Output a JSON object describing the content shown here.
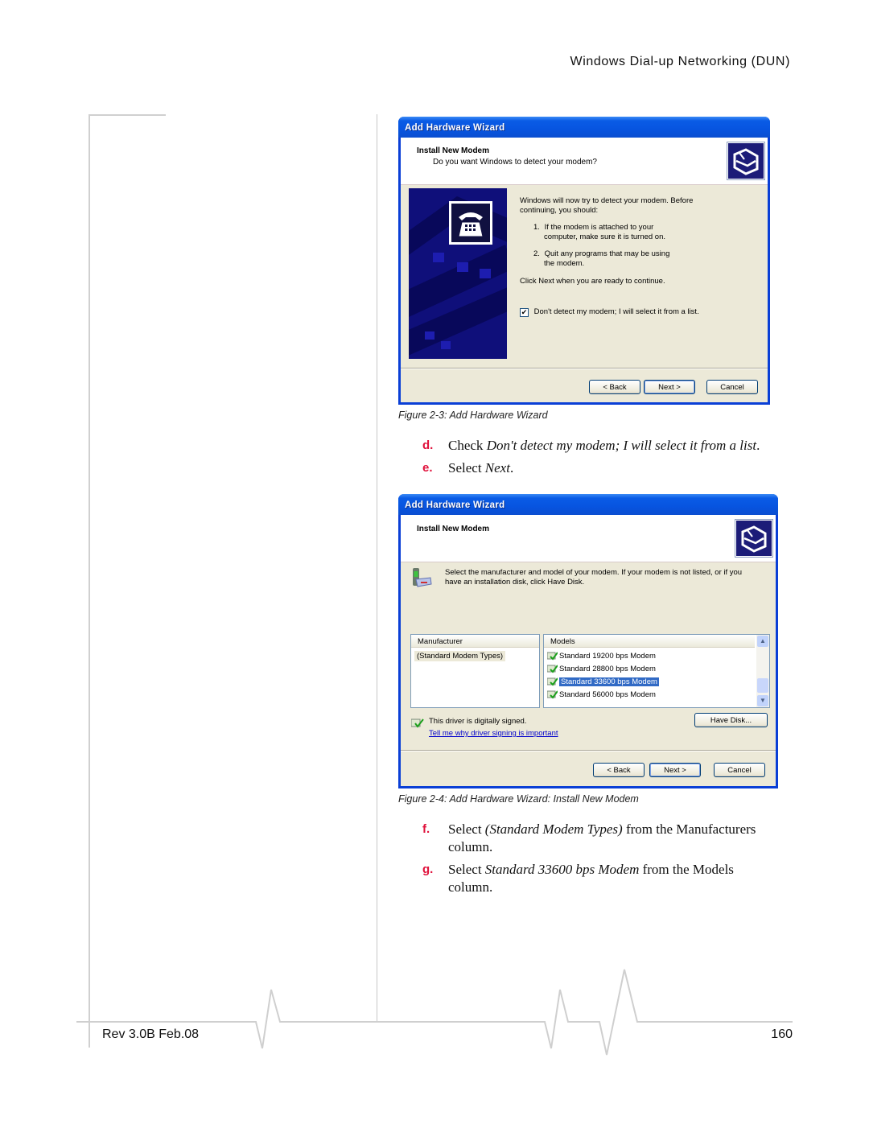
{
  "header": {
    "running_title": "Windows Dial-up Networking (DUN)"
  },
  "figure_3": {
    "window_title": "Add Hardware Wizard",
    "heading": "Install New Modem",
    "subheading": "Do you want Windows to detect your modem?",
    "intro": "Windows will now try to detect your modem.  Before continuing, you should:",
    "list": [
      {
        "num": "1.",
        "text_line1": "If the modem is attached to your",
        "text_line2": "computer, make sure it is turned on."
      },
      {
        "num": "2.",
        "text_line1": "Quit any programs that may be using",
        "text_line2": "the modem."
      }
    ],
    "continue_text": "Click Next when you are ready to continue.",
    "checkbox": {
      "label": "Don't detect my modem; I will select it from a list.",
      "checked": true
    },
    "buttons": {
      "back": "< Back",
      "next": "Next >",
      "cancel": "Cancel"
    },
    "caption": "Figure 2-3:  Add Hardware Wizard"
  },
  "steps_1": [
    {
      "label": "d.",
      "prefix": "Check ",
      "italic": "Don't detect my modem; I will select it from a list",
      "suffix": "."
    },
    {
      "label": "e.",
      "prefix": "Select ",
      "italic": "Next",
      "suffix": "."
    }
  ],
  "figure_4": {
    "window_title": "Add Hardware Wizard",
    "heading": "Install New Modem",
    "instruction_line1": "Select the manufacturer and model of your modem. If your modem is not listed, or if you",
    "instruction_line2": "have an installation disk, click Have Disk.",
    "manufacturer": {
      "header": "Manufacturer",
      "items": [
        "(Standard Modem Types)"
      ],
      "selected": "(Standard Modem Types)"
    },
    "models": {
      "header": "Models",
      "items": [
        "Standard 19200 bps Modem",
        "Standard 28800 bps Modem",
        "Standard 33600 bps Modem",
        "Standard 56000 bps Modem"
      ],
      "selected": "Standard 33600 bps Modem"
    },
    "signed_text": "This driver is digitally signed.",
    "signing_link": "Tell me why driver signing is important",
    "buttons": {
      "have_disk": "Have Disk...",
      "back": "< Back",
      "next": "Next >",
      "cancel": "Cancel"
    },
    "caption": "Figure 2-4:  Add Hardware Wizard: Install New Modem"
  },
  "steps_2": [
    {
      "label": "f.",
      "prefix": "Select ",
      "italic": "(Standard Modem Types)",
      "suffix": " from the Manufacturers column."
    },
    {
      "label": "g.",
      "prefix": "Select ",
      "italic": "Standard 33600 bps Modem",
      "suffix": " from the Models column."
    }
  ],
  "footer": {
    "revision": "Rev 3.0B Feb.08",
    "page_number": "160"
  },
  "colors": {
    "step_label": "#e0123c",
    "xp_title": "#0a5ce6",
    "selection": "#316ac5"
  }
}
